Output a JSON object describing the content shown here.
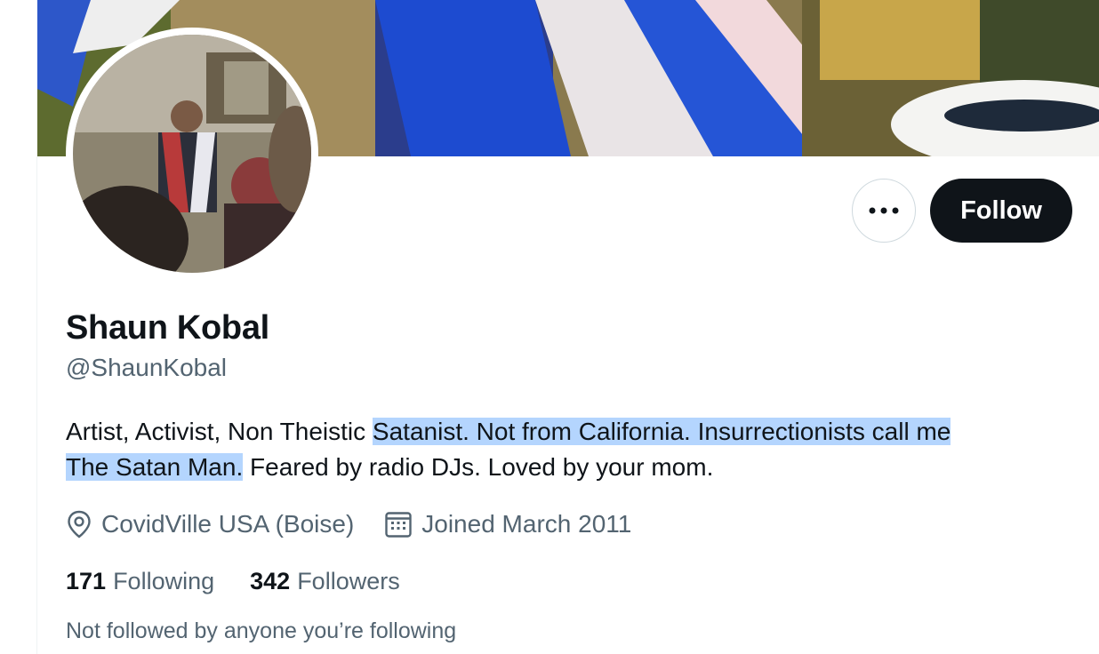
{
  "profile": {
    "display_name": "Shaun Kobal",
    "handle": "@ShaunKobal",
    "bio": {
      "part1": "Artist, Activist, Non Theistic ",
      "highlighted1": "Satanist. Not from California. Insurrectionists call me",
      "space": " ",
      "highlighted2": "The Satan Man.",
      "part2": " Feared by radio DJs. Loved by your mom."
    },
    "location": "CovidVille USA (Boise)",
    "joined": "Joined March 2011",
    "following_count": "171",
    "following_label": "Following",
    "followers_count": "342",
    "followers_label": "Followers",
    "followed_note": "Not followed by anyone you’re following"
  },
  "actions": {
    "more_icon": "ellipsis-icon",
    "follow_label": "Follow"
  },
  "icons": {
    "location": "location-pin-icon",
    "calendar": "calendar-icon"
  },
  "colors": {
    "text": "#0f1419",
    "secondary": "#536471",
    "highlight": "#b4d5fe",
    "button_dark": "#0f1419"
  }
}
